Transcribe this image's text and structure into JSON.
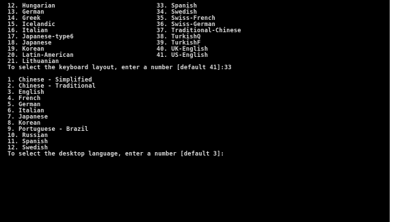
{
  "keyboard_layouts": [
    {
      "left": "12. Hungarian",
      "right": "33. Spanish"
    },
    {
      "left": "13. German",
      "right": "34. Swedish"
    },
    {
      "left": "14. Greek",
      "right": "35. Swiss-French"
    },
    {
      "left": "15. Icelandic",
      "right": "36. Swiss-German"
    },
    {
      "left": "16. Italian",
      "right": "37. Traditional-Chinese"
    },
    {
      "left": "17. Japanese-type6",
      "right": "38. TurkishQ"
    },
    {
      "left": "18. Japanese",
      "right": "39. TurkishF"
    },
    {
      "left": "19. Korean",
      "right": "40. UK-English"
    },
    {
      "left": "20. Latin-American",
      "right": "41. US-English"
    },
    {
      "left": "21. Lithuanian",
      "right": ""
    }
  ],
  "keyboard_prompt": "To select the keyboard layout, enter a number [default 41]:33",
  "desktop_languages": [
    "1. Chinese - Simplified",
    "2. Chinese - Traditional",
    "3. English",
    "4. French",
    "5. German",
    "6. Italian",
    "7. Japanese",
    "8. Korean",
    "9. Portuguese - Brazil",
    "10. Russian",
    "11. Spanish",
    "12. Swedish"
  ],
  "desktop_prompt": "To select the desktop language, enter a number [default 3]:"
}
